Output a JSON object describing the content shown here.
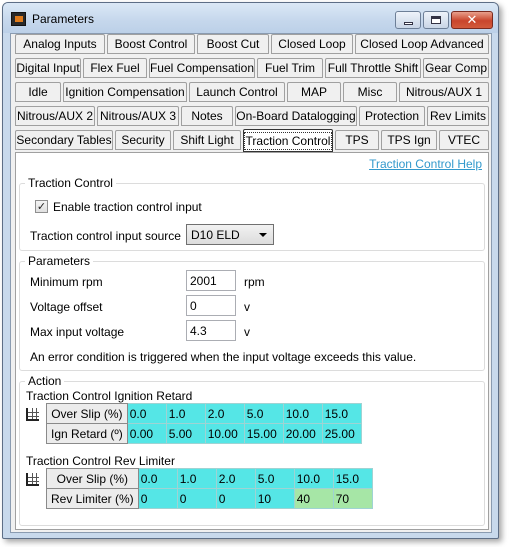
{
  "window": {
    "title": "Parameters"
  },
  "tabs": {
    "row1": [
      "Analog Inputs",
      "Boost Control",
      "Boost Cut",
      "Closed Loop",
      "Closed Loop Advanced"
    ],
    "row2": [
      "Digital Input",
      "Flex Fuel",
      "Fuel Compensation",
      "Fuel Trim",
      "Full Throttle Shift",
      "Gear Comp"
    ],
    "row3": [
      "Idle",
      "Ignition Compensation",
      "Launch Control",
      "MAP",
      "Misc",
      "Nitrous/AUX 1"
    ],
    "row4": [
      "Nitrous/AUX 2",
      "Nitrous/AUX 3",
      "Notes",
      "On-Board Datalogging",
      "Protection",
      "Rev Limits"
    ],
    "row5": [
      "Secondary Tables",
      "Security",
      "Shift Light",
      "Traction Control",
      "TPS",
      "TPS Ign",
      "VTEC"
    ],
    "active": "Traction Control"
  },
  "help_link": "Traction Control Help",
  "traction_control": {
    "title": "Traction Control",
    "enable_label": "Enable traction control input",
    "enable_checked": true,
    "check_glyph": "✓",
    "source_label": "Traction control input source",
    "source_value": "D10 ELD"
  },
  "parameters": {
    "title": "Parameters",
    "min_rpm_label": "Minimum rpm",
    "min_rpm_value": "2001",
    "min_rpm_unit": "rpm",
    "voltage_offset_label": "Voltage offset",
    "voltage_offset_value": "0",
    "voltage_offset_unit": "v",
    "max_input_label": "Max input voltage",
    "max_input_value": "4.3",
    "max_input_unit": "v",
    "note": "An error condition is triggered when the input voltage exceeds this value."
  },
  "action": {
    "title": "Action",
    "ign_retard": {
      "title": "Traction Control Ignition Retard",
      "row1_label": "Over Slip (%)",
      "row1_values": [
        "0.0",
        "1.0",
        "2.0",
        "5.0",
        "10.0",
        "15.0"
      ],
      "row2_label": "Ign Retard (º)",
      "row2_values": [
        "0.00",
        "5.00",
        "10.00",
        "15.00",
        "20.00",
        "25.00"
      ]
    },
    "rev_limiter": {
      "title": "Traction Control Rev Limiter",
      "row1_label": "Over Slip (%)",
      "row1_values": [
        "0.0",
        "1.0",
        "2.0",
        "5.0",
        "10.0",
        "15.0"
      ],
      "row2_label": "Rev Limiter (%)",
      "row2_values": [
        "0",
        "0",
        "0",
        "10",
        "40",
        "70"
      ]
    }
  },
  "colors": {
    "table_cell": "#55e6e6",
    "table_cell_green": "#a6e6a6",
    "link": "#3399cc"
  },
  "icons": {
    "app": "app-icon",
    "grid": "grid-icon"
  }
}
